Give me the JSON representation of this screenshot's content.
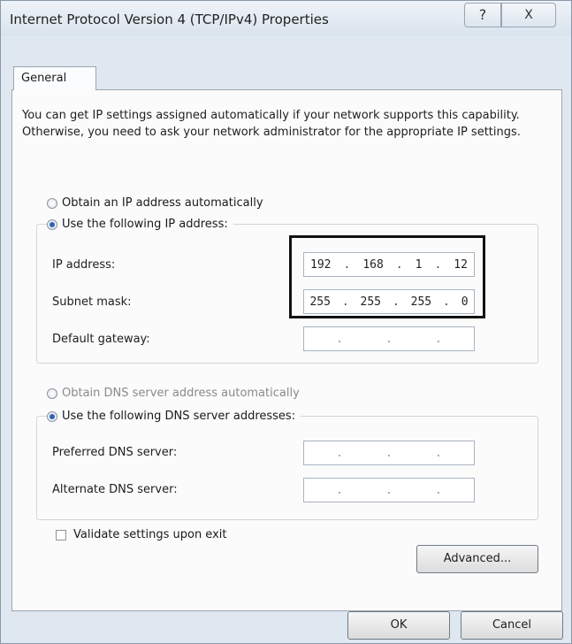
{
  "window": {
    "title": "Internet Protocol Version 4 (TCP/IPv4) Properties",
    "help_glyph": "?",
    "close_glyph": "X"
  },
  "tabs": [
    {
      "label": "General"
    }
  ],
  "description": "You can get IP settings assigned automatically if your network supports this capability. Otherwise, you need to ask your network administrator for the appropriate IP settings.",
  "ip": {
    "auto_label": "Obtain an IP address automatically",
    "auto_selected": false,
    "manual_label": "Use the following IP address:",
    "manual_selected": true,
    "fields": [
      {
        "label": "IP address:",
        "octets": [
          "192",
          "168",
          "1",
          "12"
        ]
      },
      {
        "label": "Subnet mask:",
        "octets": [
          "255",
          "255",
          "255",
          "0"
        ]
      },
      {
        "label": "Default gateway:",
        "octets": [
          "",
          "",
          "",
          ""
        ]
      }
    ]
  },
  "dns": {
    "auto_label": "Obtain DNS server address automatically",
    "auto_selected": false,
    "manual_label": "Use the following DNS server addresses:",
    "manual_selected": true,
    "fields": [
      {
        "label": "Preferred DNS server:",
        "octets": [
          "",
          "",
          "",
          ""
        ]
      },
      {
        "label": "Alternate DNS server:",
        "octets": [
          "",
          "",
          "",
          ""
        ]
      }
    ]
  },
  "validate_label": "Validate settings upon exit",
  "validate_checked": false,
  "buttons": {
    "advanced": "Advanced...",
    "ok": "OK",
    "cancel": "Cancel"
  },
  "colors": {
    "highlight_border": "#111111",
    "radio_selected": "#2f62b8"
  }
}
